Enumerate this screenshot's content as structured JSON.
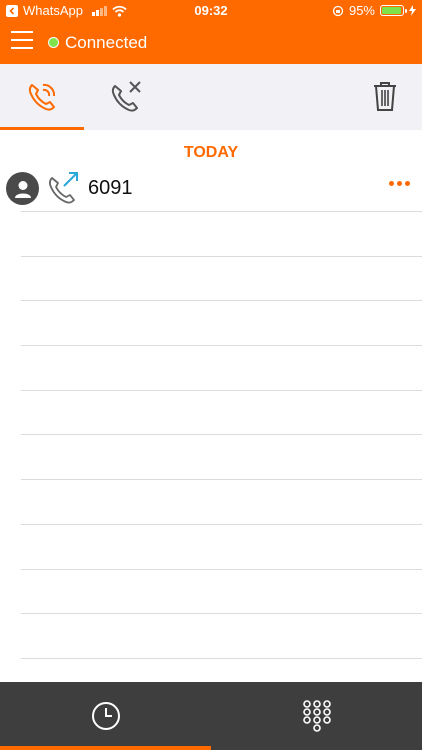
{
  "status_bar": {
    "back_app": "WhatsApp",
    "time": "09:32",
    "battery_percent": "95%",
    "battery_level": 0.95,
    "battery_color": "#7fe24a"
  },
  "header": {
    "connection_status": "Connected",
    "status_color": "#7fe24a",
    "accent_color": "#ff6a00"
  },
  "tabs": [
    {
      "name": "all-calls",
      "icon": "phone-recent-icon",
      "active": true
    },
    {
      "name": "missed-calls",
      "icon": "phone-missed-icon",
      "active": false
    }
  ],
  "toolbar": {
    "delete_icon": "trash-icon"
  },
  "call_log": {
    "section_title": "TODAY",
    "entries": [
      {
        "number": "6091",
        "direction": "outgoing",
        "icon": "phone-outgoing-icon"
      }
    ]
  },
  "bottom_nav": [
    {
      "name": "recents",
      "icon": "clock-icon",
      "active": true
    },
    {
      "name": "keypad",
      "icon": "keypad-icon",
      "active": false
    }
  ]
}
